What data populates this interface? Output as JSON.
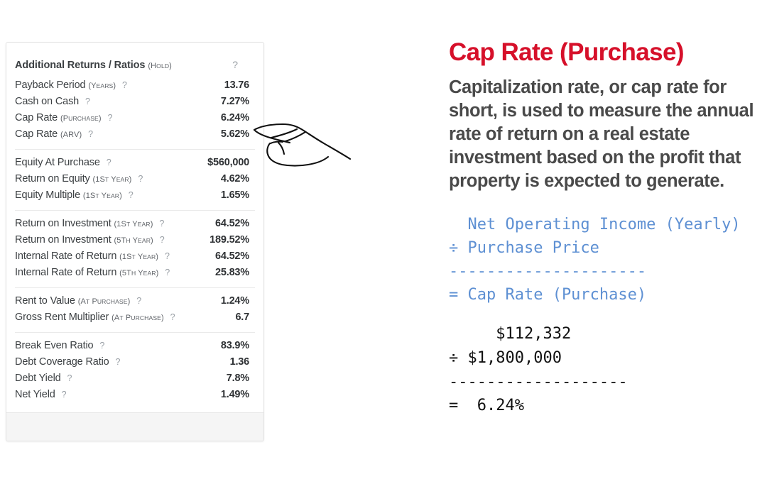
{
  "card": {
    "header": {
      "title": "Additional Returns / Ratios",
      "qualifier": "(Hold)",
      "help_icon": "?"
    },
    "help_icon": "?",
    "groups": [
      {
        "rows": [
          {
            "label": "Payback Period",
            "qualifier": "(Years)",
            "value": "13.76"
          },
          {
            "label": "Cash on Cash",
            "qualifier": "",
            "value": "7.27%"
          },
          {
            "label": "Cap Rate",
            "qualifier": "(Purchase)",
            "value": "6.24%"
          },
          {
            "label": "Cap Rate",
            "qualifier": "(ARV)",
            "value": "5.62%"
          }
        ]
      },
      {
        "rows": [
          {
            "label": "Equity At Purchase",
            "qualifier": "",
            "value": "$560,000"
          },
          {
            "label": "Return on Equity",
            "qualifier": "(1st Year)",
            "value": "4.62%"
          },
          {
            "label": "Equity Multiple",
            "qualifier": "(1st Year)",
            "value": "1.65%"
          }
        ]
      },
      {
        "rows": [
          {
            "label": "Return on Investment",
            "qualifier": "(1st Year)",
            "value": "64.52%"
          },
          {
            "label": "Return on Investment",
            "qualifier": "(5th Year)",
            "value": "189.52%"
          },
          {
            "label": "Internal Rate of Return",
            "qualifier": "(1st Year)",
            "value": "64.52%"
          },
          {
            "label": "Internal Rate of Return",
            "qualifier": "(5th Year)",
            "value": "25.83%"
          }
        ]
      },
      {
        "rows": [
          {
            "label": "Rent to Value",
            "qualifier": "(At Purchase)",
            "value": "1.24%"
          },
          {
            "label": "Gross Rent Multiplier",
            "qualifier": "(At Purchase)",
            "value": "6.7"
          }
        ]
      },
      {
        "rows": [
          {
            "label": "Break Even Ratio",
            "qualifier": "",
            "value": "83.9%"
          },
          {
            "label": "Debt Coverage Ratio",
            "qualifier": "",
            "value": "1.36"
          },
          {
            "label": "Debt Yield",
            "qualifier": "",
            "value": "7.8%"
          },
          {
            "label": "Net Yield",
            "qualifier": "",
            "value": "1.49%"
          }
        ]
      }
    ]
  },
  "explanation": {
    "title": "Cap Rate (Purchase)",
    "description": "Capitalization rate, or cap rate for short, is used to measure the annual rate of return on a real estate investment based on the profit that property is expected to generate.",
    "formula_symbolic": "  Net Operating Income (Yearly)\n÷ Purchase Price\n---------------------\n= Cap Rate (Purchase)",
    "formula_numeric": "     $112,332\n÷ $1,800,000\n-------------------\n=  6.24%"
  },
  "colors": {
    "title_red": "#d6102a",
    "formula_blue": "#5e90d3",
    "text_gray": "#4a4a4a",
    "label_gray": "#3c4043",
    "help_gray": "#9aa0a6",
    "footer_gray": "#f5f5f5"
  },
  "pointer": {
    "icon": "hand-pointing-left"
  }
}
